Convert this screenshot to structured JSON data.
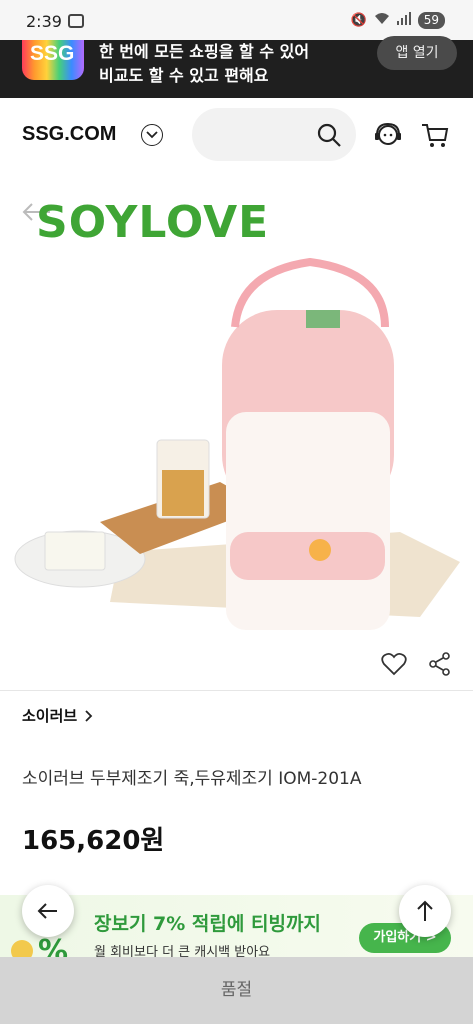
{
  "status_bar": {
    "time": "2:39",
    "battery": "59"
  },
  "app_banner": {
    "logo": "SSG",
    "line1": "한 번에 모든 쇼핑을 할 수 있어",
    "line2": "비교도 할 수 있고 편해요",
    "open_button": "앱 열기"
  },
  "header": {
    "brand": "SSG.COM"
  },
  "product": {
    "image_brand_logo": "SOYLOVE",
    "brand_link": "소이러브",
    "name": "소이러브 두부제조기 죽,두유제조기 IOM-201A",
    "price": "165,620원"
  },
  "promo": {
    "title": "장보기 7% 적립에 티빙까지",
    "subtitle": "월 회비보다 더 큰 캐시백 받아요",
    "button": "가입하기 >"
  },
  "bottom": {
    "soldout_label": "품절"
  },
  "colors": {
    "accent_green": "#46b54c",
    "brand_dark": "#1f1f1f"
  }
}
